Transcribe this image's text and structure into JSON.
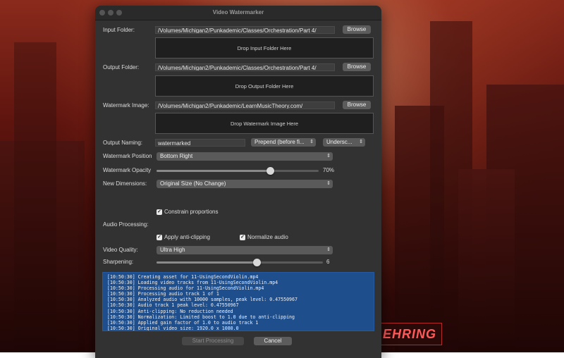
{
  "window": {
    "title": "Video Watermarker"
  },
  "input_folder": {
    "label": "Input Folder:",
    "path": "/Volumes/Michigan2/Punkademic/Classes/Orchestration/Part 4/",
    "browse": "Browse",
    "drop": "Drop Input Folder Here"
  },
  "output_folder": {
    "label": "Output Folder:",
    "path": "/Volumes/Michigan2/Punkademic/Classes/Orchestration/Part 4/",
    "browse": "Browse",
    "drop": "Drop Output Folder Here"
  },
  "watermark_image": {
    "label": "Watermark Image:",
    "path": "/Volumes/Michigan2/Punkademic/LearnMusicTheory.com/",
    "browse": "Browse",
    "drop": "Drop Watermark Image Here"
  },
  "output_naming": {
    "label": "Output Naming:",
    "value": "watermarked",
    "position_option": "Prepend (before fi...",
    "separator_option": "Undersc..."
  },
  "watermark_position": {
    "label": "Watermark Position",
    "value": "Bottom Right"
  },
  "watermark_opacity": {
    "label": "Watermark Opacity",
    "value": 0.7,
    "value_text": "70%"
  },
  "new_dimensions": {
    "label": "New Dimensions:",
    "value": "Original Size (No Change)"
  },
  "constrain": {
    "label": "Constrain proportions",
    "checked": true
  },
  "audio_processing": {
    "label": "Audio Processing:",
    "anti_clipping": {
      "label": "Apply anti-clipping",
      "checked": true
    },
    "normalize": {
      "label": "Normalize audio",
      "checked": true
    }
  },
  "video_quality": {
    "label": "Video Quality:",
    "value": "Ultra High"
  },
  "sharpening": {
    "label": "Sharpening:",
    "value": 6,
    "fraction": 0.6,
    "value_text": "6"
  },
  "log": {
    "lines": [
      "[10:50:30] Creating asset for 11-UsingSecondViolin.mp4",
      "[10:50:30] Loading video tracks from 11-UsingSecondViolin.mp4",
      "[10:50:30] Processing audio for 11-UsingSecondViolin.mp4",
      "[10:50:30] Processing audio track 1 of 1",
      "[10:50:30] Analyzed audio with 10000 samples, peak level: 0.47550967",
      "[10:50:30] Audio track 1 peak level: 0.47550967",
      "[10:50:30] Anti-clipping: No reduction needed",
      "[10:50:30] Normalization: Limited boost to 1.0 due to anti-clipping",
      "[10:50:30] Applied gain factor of 1.0 to audio track 1",
      "[10:50:30] Original video size: 1920.0 x 1080.0"
    ]
  },
  "actions": {
    "start": "Start Processing",
    "cancel": "Cancel"
  },
  "colors": {
    "window_bg": "#323232",
    "log_bg": "#1e4e8c",
    "button_bg": "#5c5c5c"
  }
}
